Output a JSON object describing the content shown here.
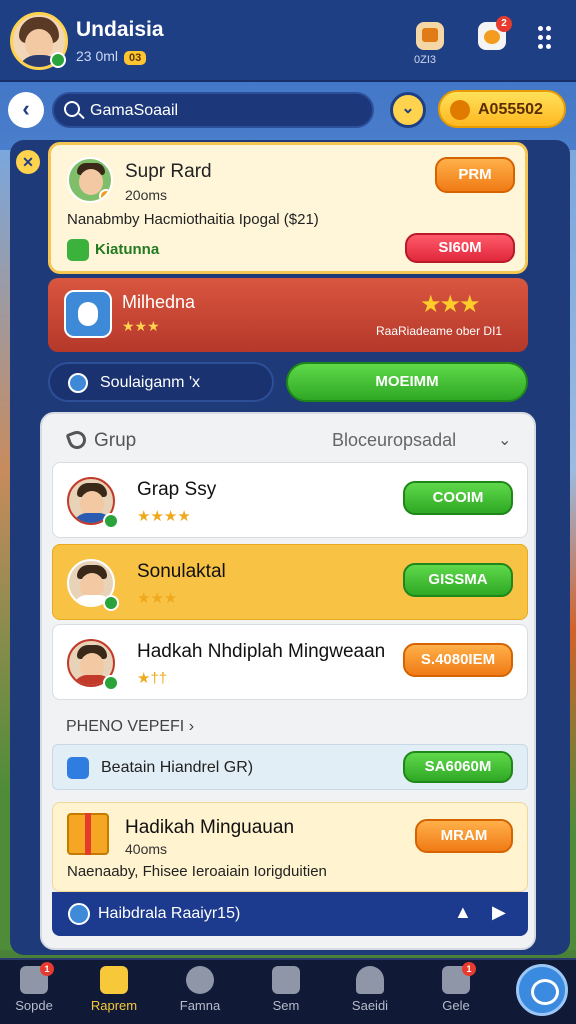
{
  "header": {
    "user_name": "Undaisia",
    "user_sub": "23 0ml",
    "user_badge": "03",
    "icon_badge_2": "2",
    "caption": "0ZI3",
    "menu_icon": "dots-vertical-icon"
  },
  "search": {
    "value": "GamaSoaail"
  },
  "coins": {
    "value": "A055502"
  },
  "featured": {
    "title": "Supr Rard",
    "sub": "20oms",
    "desc": "Nanabmby Hacmiothaitia Ipogal ($21)",
    "tag": "Kiatunna",
    "btn_top": "PRM",
    "btn_bottom": "SI60M"
  },
  "promo": {
    "title": "Milhedna",
    "stars_small": "★★★",
    "note": "RaaRiadeame ober DI1"
  },
  "actions": {
    "left_label": "Soulaiganm 'x",
    "right_label": "MOEIMM"
  },
  "group": {
    "title": "Grup",
    "right_label": "Bloceuropsadal",
    "rows": [
      {
        "name": "Grap Ssy",
        "stars": "★★★★",
        "button": "COOIM"
      },
      {
        "name": "Sonulaktal",
        "stars": "★★★",
        "button": "GISSMA"
      },
      {
        "name": "Hadkah Nhdiplah Mingweaan",
        "stars": "★††",
        "button": "S.4080IEM"
      }
    ],
    "section_link": "PHENO VEPEFI",
    "line_row": {
      "text": "Beatain Hiandrel GR)",
      "button": "SA6060M"
    },
    "gift": {
      "name": "Hadikah Minguauan",
      "sub": "40oms",
      "desc": "Naenaaby, Fhisee Ieroaiain Iorigduitien",
      "button": "MRAM"
    },
    "bottom_bar": "Haibdrala Raaiyr15)"
  },
  "nav": [
    {
      "label": "Sopde",
      "badge": "1"
    },
    {
      "label": "Raprem",
      "badge": ""
    },
    {
      "label": "Famna",
      "badge": ""
    },
    {
      "label": "Sem",
      "badge": ""
    },
    {
      "label": "Saeidi",
      "badge": ""
    },
    {
      "label": "Gele",
      "badge": "1"
    }
  ],
  "colors": {
    "header_bg": "#1f3f85",
    "accent_yellow": "#ffd34d",
    "accent_orange": "#f07b15",
    "accent_green": "#2fa825",
    "accent_red": "#e0283c",
    "selected_row": "#f8c244"
  }
}
